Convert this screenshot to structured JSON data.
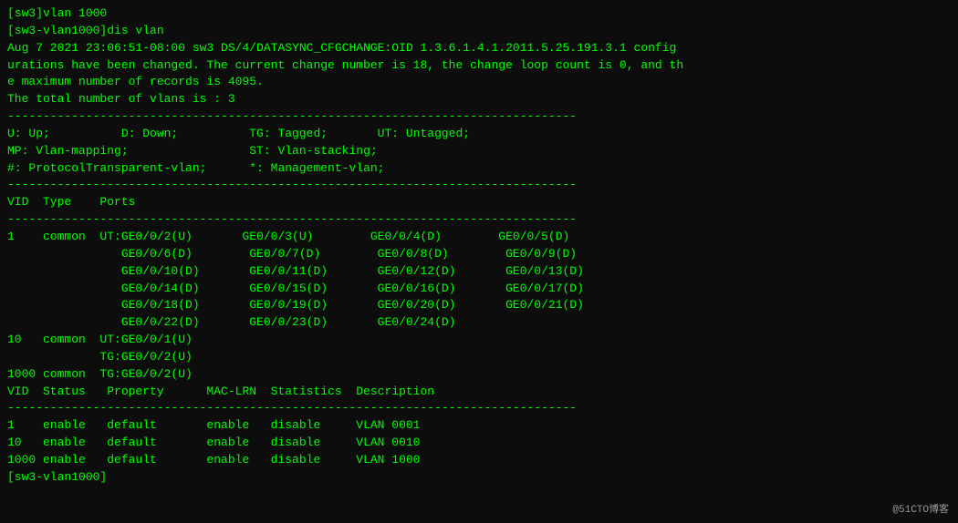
{
  "terminal": {
    "lines": [
      "[sw3]vlan 1000",
      "[sw3-vlan1000]dis vlan",
      "Aug 7 2021 23:06:51-08:00 sw3 DS/4/DATASYNC_CFGCHANGE:OID 1.3.6.1.4.1.2011.5.25.191.3.1 config",
      "urations have been changed. The current change number is 18, the change loop count is 0, and th",
      "e maximum number of records is 4095.",
      "The total number of vlans is : 3",
      "--------------------------------------------------------------------------------",
      "U: Up;          D: Down;          TG: Tagged;       UT: Untagged;",
      "MP: Vlan-mapping;                 ST: Vlan-stacking;",
      "#: ProtocolTransparent-vlan;      *: Management-vlan;",
      "--------------------------------------------------------------------------------",
      "",
      "VID  Type    Ports",
      "--------------------------------------------------------------------------------",
      "1    common  UT:GE0/0/2(U)       GE0/0/3(U)        GE0/0/4(D)        GE0/0/5(D)",
      "                GE0/0/6(D)        GE0/0/7(D)        GE0/0/8(D)        GE0/0/9(D)",
      "                GE0/0/10(D)       GE0/0/11(D)       GE0/0/12(D)       GE0/0/13(D)",
      "                GE0/0/14(D)       GE0/0/15(D)       GE0/0/16(D)       GE0/0/17(D)",
      "                GE0/0/18(D)       GE0/0/19(D)       GE0/0/20(D)       GE0/0/21(D)",
      "                GE0/0/22(D)       GE0/0/23(D)       GE0/0/24(D)",
      "10   common  UT:GE0/0/1(U)",
      "             TG:GE0/0/2(U)",
      "1000 common  TG:GE0/0/2(U)",
      "",
      "VID  Status   Property      MAC-LRN  Statistics  Description",
      "--------------------------------------------------------------------------------",
      "1    enable   default       enable   disable     VLAN 0001",
      "10   enable   default       enable   disable     VLAN 0010",
      "1000 enable   default       enable   disable     VLAN 1000",
      "[sw3-vlan1000]"
    ],
    "watermark": "@51CTO博客"
  }
}
